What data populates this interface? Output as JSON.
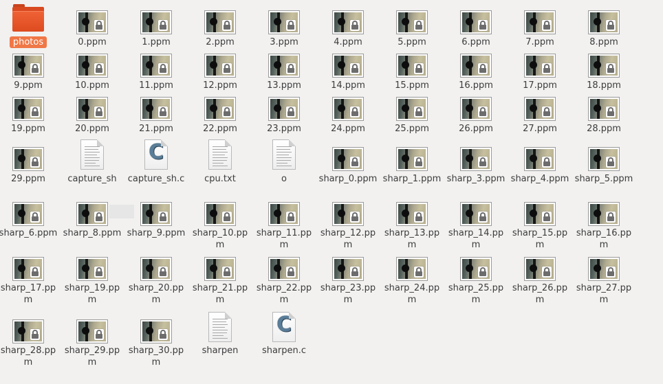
{
  "files": [
    {
      "name": "photos",
      "type": "folder",
      "selected": true
    },
    {
      "name": "0.ppm",
      "type": "image"
    },
    {
      "name": "1.ppm",
      "type": "image"
    },
    {
      "name": "2.ppm",
      "type": "image"
    },
    {
      "name": "3.ppm",
      "type": "image"
    },
    {
      "name": "4.ppm",
      "type": "image"
    },
    {
      "name": "5.ppm",
      "type": "image"
    },
    {
      "name": "6.ppm",
      "type": "image"
    },
    {
      "name": "7.ppm",
      "type": "image"
    },
    {
      "name": "8.ppm",
      "type": "image"
    },
    {
      "name": "9.ppm",
      "type": "image"
    },
    {
      "name": "10.ppm",
      "type": "image"
    },
    {
      "name": "11.ppm",
      "type": "image"
    },
    {
      "name": "12.ppm",
      "type": "image"
    },
    {
      "name": "13.ppm",
      "type": "image"
    },
    {
      "name": "14.ppm",
      "type": "image"
    },
    {
      "name": "15.ppm",
      "type": "image"
    },
    {
      "name": "16.ppm",
      "type": "image"
    },
    {
      "name": "17.ppm",
      "type": "image"
    },
    {
      "name": "18.ppm",
      "type": "image"
    },
    {
      "name": "19.ppm",
      "type": "image"
    },
    {
      "name": "20.ppm",
      "type": "image"
    },
    {
      "name": "21.ppm",
      "type": "image"
    },
    {
      "name": "22.ppm",
      "type": "image"
    },
    {
      "name": "23.ppm",
      "type": "image"
    },
    {
      "name": "24.ppm",
      "type": "image"
    },
    {
      "name": "25.ppm",
      "type": "image"
    },
    {
      "name": "26.ppm",
      "type": "image"
    },
    {
      "name": "27.ppm",
      "type": "image"
    },
    {
      "name": "28.ppm",
      "type": "image"
    },
    {
      "name": "29.ppm",
      "type": "image"
    },
    {
      "name": "capture_sh",
      "type": "text"
    },
    {
      "name": "capture_sh.c",
      "type": "csource"
    },
    {
      "name": "cpu.txt",
      "type": "text"
    },
    {
      "name": "o",
      "type": "text"
    },
    {
      "name": "sharp_0.ppm",
      "type": "image"
    },
    {
      "name": "sharp_1.ppm",
      "type": "image"
    },
    {
      "name": "sharp_3.ppm",
      "type": "image"
    },
    {
      "name": "sharp_4.ppm",
      "type": "image"
    },
    {
      "name": "sharp_5.ppm",
      "type": "image"
    },
    {
      "name": "sharp_6.ppm",
      "type": "image"
    },
    {
      "name": "sharp_8.ppm",
      "type": "image"
    },
    {
      "name": "sharp_9.ppm",
      "type": "image"
    },
    {
      "name": "sharp_10.ppm",
      "type": "image"
    },
    {
      "name": "sharp_11.ppm",
      "type": "image"
    },
    {
      "name": "sharp_12.ppm",
      "type": "image"
    },
    {
      "name": "sharp_13.ppm",
      "type": "image"
    },
    {
      "name": "sharp_14.ppm",
      "type": "image"
    },
    {
      "name": "sharp_15.ppm",
      "type": "image"
    },
    {
      "name": "sharp_16.ppm",
      "type": "image"
    },
    {
      "name": "sharp_17.ppm",
      "type": "image"
    },
    {
      "name": "sharp_19.ppm",
      "type": "image"
    },
    {
      "name": "sharp_20.ppm",
      "type": "image"
    },
    {
      "name": "sharp_21.ppm",
      "type": "image"
    },
    {
      "name": "sharp_22.ppm",
      "type": "image"
    },
    {
      "name": "sharp_23.ppm",
      "type": "image"
    },
    {
      "name": "sharp_24.ppm",
      "type": "image"
    },
    {
      "name": "sharp_25.ppm",
      "type": "image"
    },
    {
      "name": "sharp_26.ppm",
      "type": "image"
    },
    {
      "name": "sharp_27.ppm",
      "type": "image"
    },
    {
      "name": "sharp_28.ppm",
      "type": "image"
    },
    {
      "name": "sharp_29.ppm",
      "type": "image"
    },
    {
      "name": "sharp_30.ppm",
      "type": "image"
    },
    {
      "name": "sharpen",
      "type": "text"
    },
    {
      "name": "sharpen.c",
      "type": "csource"
    }
  ],
  "colors": {
    "background": "#f2f1f0",
    "selection": "#f07746",
    "folder": "#e5541f",
    "label_text": "#3c3c3c"
  },
  "icons": {
    "folder": "folder-icon",
    "image": "image-thumbnail-icon",
    "text": "text-file-icon",
    "csource": "c-source-file-icon",
    "lock_overlay": "lock-icon"
  }
}
